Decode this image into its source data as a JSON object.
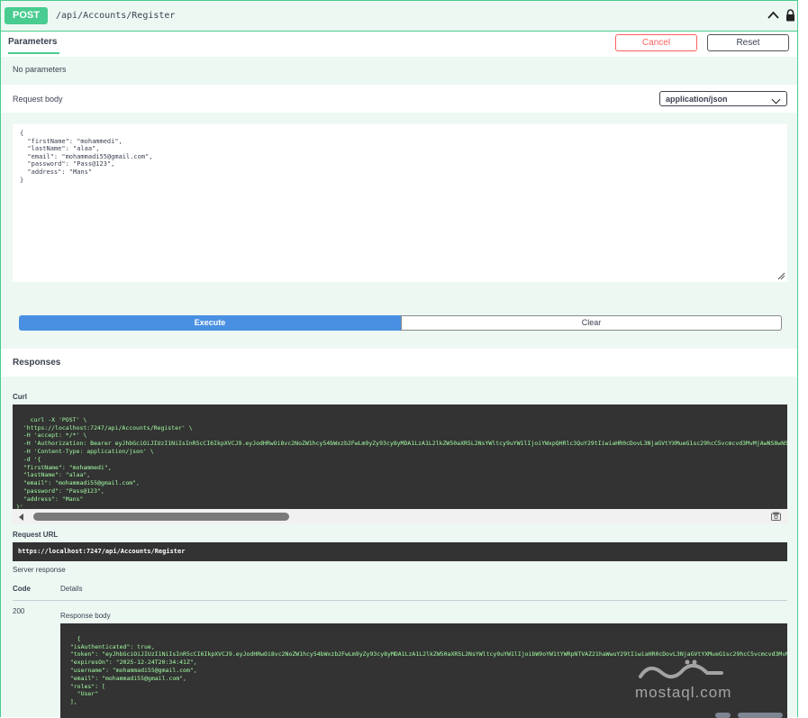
{
  "endpoint": {
    "method": "POST",
    "path": "/api/Accounts/Register"
  },
  "icons": {
    "collapse": "chevron-up-icon",
    "auth": "lock-icon",
    "copy": "copy-icon",
    "resize": "resize-handle-icon"
  },
  "colors": {
    "post": "#49cc90",
    "execute": "#4990e2",
    "cancel": "#ff6060",
    "code_bg": "#333333"
  },
  "parameters": {
    "tab_label": "Parameters",
    "cancel_label": "Cancel",
    "reset_label": "Reset",
    "empty_text": "No parameters"
  },
  "request_body": {
    "label": "Request body",
    "content_type": "application/json",
    "value": "{\n  \"firstName\": \"mohammedi\",\n  \"lastName\": \"alaa\",\n  \"email\": \"mohammadi55@gmail.com\",\n  \"password\": \"Pass@123\",\n  \"address\": \"Mans\"\n}"
  },
  "actions": {
    "execute_label": "Execute",
    "clear_label": "Clear"
  },
  "responses": {
    "title": "Responses",
    "curl_label": "Curl",
    "curl_text": "curl -X 'POST' \\\n  'https://localhost:7247/api/Accounts/Register' \\\n  -H 'accept: */*' \\\n  -H 'Authorization: Bearer eyJhbGciOiJIUzI1NiIsInR5cCI6IkpXVCJ9.eyJodHRwOi8vc2NoZW1hcy54bWxzb2FwLm9yZy93cy8yMDA1LzA1L2lkZW50aXR5L2NsYWltcy9uYW1lIjoiYWxpQHRlc3QuY29tIiwiaHR0cDovL3NjaGVtYXMueG1sc29hcC5vcmcvd3MvMjAwNS8wNS9pZGVudGl0eS9jbGFpbXMvbmFtZWlkZW50aWZpZXIiOiJiZjNkMzg1YS03ZTQ0LTQxNzQtYmM4NS1mYzZhMGJmOTE4MzQiLCJqdGkiOiIyMmE4MzQwYi0xYWFiLTQwZjItYjNjMi1lZmNjYTk1NTRkMWMiLCJodHRwOi8vc2NoZW1hcy5taWNyb3NvZnQuY29tL3dzLzIwMDgvMDYvaWRlbnRpdHkvY2xhaW1zL3JvbGUiOiJVc2VyIiwiZXhwIjoxNzM1MDgyNTAzLCJpc3MiOiJodHRwczovL2xvY2FsaG9zdDo3MjQ3IiwiYXVkIjoiTXlTZWN1cmVLZXkifQ.abc' \\\n  -H 'Content-Type: application/json' \\\n  -d '{\n  \"firstName\": \"mohammedi\",\n  \"lastName\": \"alaa\",\n  \"email\": \"mohammadi55@gmail.com\",\n  \"password\": \"Pass@123\",\n  \"address\": \"Mans\"\n}'",
    "request_url_label": "Request URL",
    "request_url": "https://localhost:7247/api/Accounts/Register",
    "server_response_label": "Server response",
    "code_header": "Code",
    "details_header": "Details",
    "status_code": "200",
    "response_body_label": "Response body",
    "response_body": "{\n  \"isAuthenticated\": true,\n  \"token\": \"eyJhbGciOiJIUzI1NiIsInR5cCI6IkpXVCJ9.eyJodHRwOi8vc2NoZW1hcy54bWxzb2FwLm9yZy93cy8yMDA1LzA1L2lkZW50aXR5L2NsYWltcy9uYW1lIjoibW9oYW1tYWRpNTVAZ21haWwuY29tIiwiaHR0cDovL3NjaGVtYXMueG1sc29hcC5vcmcvd3MvMjAwNS8wNS9pZGVudGl0eS9jbGFpbXMvbmFtZWlkZW50aWZpZXIiOiJiZjNkMzg1YS03ZTQ0LTQxNzQtYmM4NS1mYzZhMGJmOTE4MzQiLCJqdGkiOiIyMmE4MzQwYi0xYWFiLTQwZjItYjNjMi1lZmNjYTk1NTRkMWMiLCJodHRwOi8vc2NoZW1hcy5taWNyb3NvZnQuY29tL3dzLzIwMDgvMDYvaWRlbnRpdHkvY2xhaW1zL3JvbGUiOiJVc2VyIiwiZXhwIjoxNzM1MDgyNTAzLCJpc3MiOiJodHRwczovL2xvY2FsaG9zdDo3MjQ3IiwiYXVkIjoiTXlTZWN1cmVLZXkifQ.aOQ0-YCmQKEJvWwwPJ-MNBhVMOuxjQODicaWUSQUJIE\",\n  \"expiresOn\": \"2025-12-24T20:34:41Z\",\n  \"username\": \"mohammadi55@gmail.com\",\n  \"email\": \"mohammadi55@gmail.com\",\n  \"roles\": [\n    \"User\"\n  ],"
  },
  "watermark": {
    "text": "mostaql.com"
  }
}
